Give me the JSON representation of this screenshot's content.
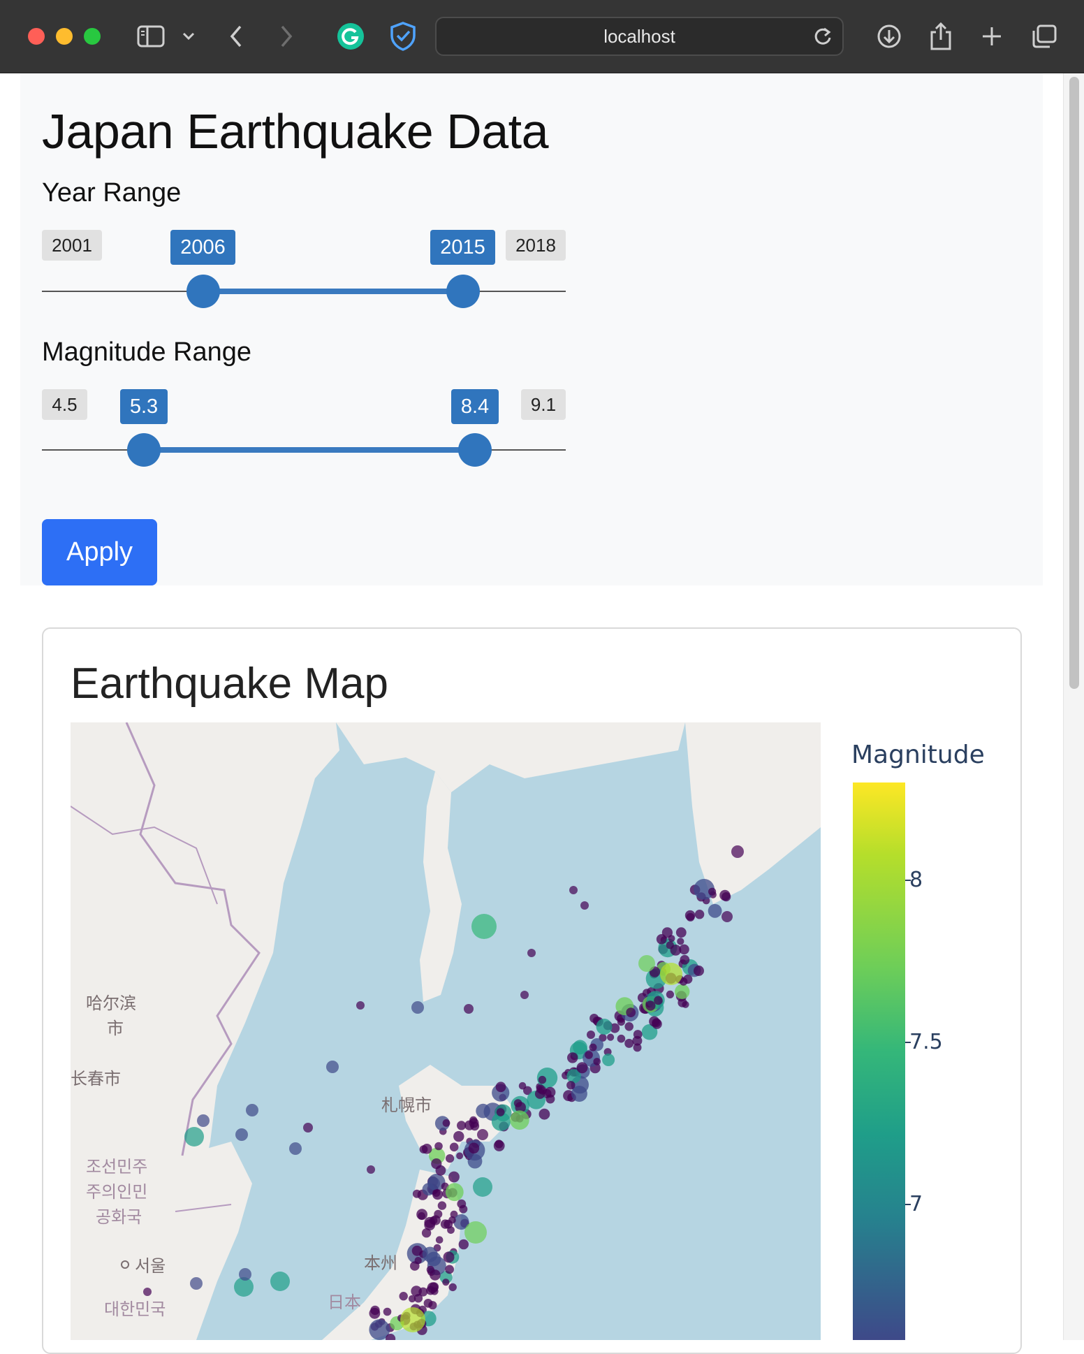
{
  "browser": {
    "url": "localhost"
  },
  "filters": {
    "title": "Japan Earthquake Data",
    "year_range": {
      "label": "Year Range",
      "min": "2001",
      "max": "2018",
      "low": "2006",
      "high": "2015"
    },
    "magnitude_range": {
      "label": "Magnitude Range",
      "min": "4.5",
      "max": "9.1",
      "low": "5.3",
      "high": "8.4"
    },
    "apply_label": "Apply"
  },
  "map_card": {
    "title": "Earthquake Map",
    "map_labels": {
      "harbin": "哈尔滨",
      "harbin_suffix": "市",
      "changchun": "长春市",
      "sapporo": "札幌市",
      "dprk_1": "조선민주",
      "dprk_2": "주의인민",
      "dprk_3": "공화국",
      "seoul": "서울",
      "rok": "대한민국",
      "honshu": "本州",
      "japan": "日本"
    },
    "colorbar": {
      "title": "Magnitude",
      "ticks": [
        "8",
        "7.5",
        "7"
      ],
      "colors": [
        "#fde725",
        "#b5de2b",
        "#6ece58",
        "#35b779",
        "#1f9e89",
        "#26828e",
        "#3e4989",
        "#440154"
      ]
    }
  }
}
